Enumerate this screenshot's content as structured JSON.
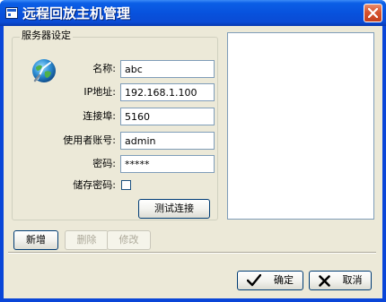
{
  "window": {
    "title": "远程回放主机管理"
  },
  "server_settings": {
    "group_label": "服务器设定",
    "fields": [
      {
        "label": "名称:",
        "value": "abc"
      },
      {
        "label": "IP地址:",
        "value": "192.168.1.100"
      },
      {
        "label": "连接埠:",
        "value": "5160"
      },
      {
        "label": "使用者账号:",
        "value": "admin"
      },
      {
        "label": "密码:",
        "value": "*****"
      }
    ],
    "save_password_label": "储存密码:",
    "save_password_checked": false,
    "test_button_label": "测试连接"
  },
  "actions": {
    "add_label": "新增",
    "delete_label": "删除",
    "modify_label": "修改"
  },
  "dialog": {
    "ok_label": "确定",
    "cancel_label": "取消"
  },
  "icons": {
    "server": "globe-icon",
    "ok": "checkmark-icon",
    "cancel": "x-icon",
    "close": "close-icon"
  }
}
